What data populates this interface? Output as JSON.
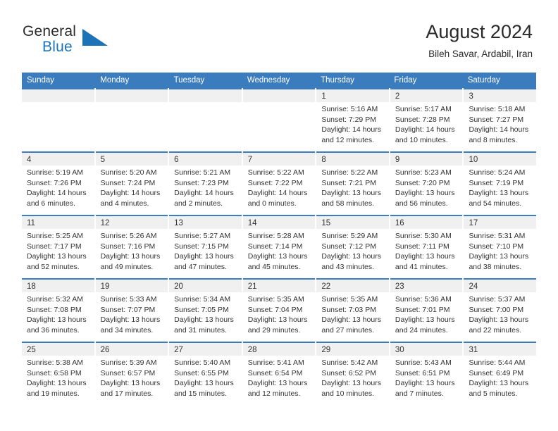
{
  "brand": {
    "word_one": "General",
    "word_two": "Blue",
    "logo_icon": "triangle-flag-icon"
  },
  "header": {
    "title": "August 2024",
    "subtitle": "Bileh Savar, Ardabil, Iran"
  },
  "colors": {
    "accent": "#3a7cbe",
    "brand_blue": "#1c73b8",
    "day_band": "#f0f0f0",
    "text": "#333333"
  },
  "weekdays": [
    "Sunday",
    "Monday",
    "Tuesday",
    "Wednesday",
    "Thursday",
    "Friday",
    "Saturday"
  ],
  "chart_data": {
    "type": "table",
    "title": "August 2024",
    "subtitle": "Bileh Savar, Ardabil, Iran",
    "columns": [
      "Sunday",
      "Monday",
      "Tuesday",
      "Wednesday",
      "Thursday",
      "Friday",
      "Saturday"
    ],
    "days": [
      {
        "day": 1,
        "sunrise": "5:16 AM",
        "sunset": "7:29 PM",
        "daylight_hours": 14,
        "daylight_minutes": 12
      },
      {
        "day": 2,
        "sunrise": "5:17 AM",
        "sunset": "7:28 PM",
        "daylight_hours": 14,
        "daylight_minutes": 10
      },
      {
        "day": 3,
        "sunrise": "5:18 AM",
        "sunset": "7:27 PM",
        "daylight_hours": 14,
        "daylight_minutes": 8
      },
      {
        "day": 4,
        "sunrise": "5:19 AM",
        "sunset": "7:26 PM",
        "daylight_hours": 14,
        "daylight_minutes": 6
      },
      {
        "day": 5,
        "sunrise": "5:20 AM",
        "sunset": "7:24 PM",
        "daylight_hours": 14,
        "daylight_minutes": 4
      },
      {
        "day": 6,
        "sunrise": "5:21 AM",
        "sunset": "7:23 PM",
        "daylight_hours": 14,
        "daylight_minutes": 2
      },
      {
        "day": 7,
        "sunrise": "5:22 AM",
        "sunset": "7:22 PM",
        "daylight_hours": 14,
        "daylight_minutes": 0
      },
      {
        "day": 8,
        "sunrise": "5:22 AM",
        "sunset": "7:21 PM",
        "daylight_hours": 13,
        "daylight_minutes": 58
      },
      {
        "day": 9,
        "sunrise": "5:23 AM",
        "sunset": "7:20 PM",
        "daylight_hours": 13,
        "daylight_minutes": 56
      },
      {
        "day": 10,
        "sunrise": "5:24 AM",
        "sunset": "7:19 PM",
        "daylight_hours": 13,
        "daylight_minutes": 54
      },
      {
        "day": 11,
        "sunrise": "5:25 AM",
        "sunset": "7:17 PM",
        "daylight_hours": 13,
        "daylight_minutes": 52
      },
      {
        "day": 12,
        "sunrise": "5:26 AM",
        "sunset": "7:16 PM",
        "daylight_hours": 13,
        "daylight_minutes": 49
      },
      {
        "day": 13,
        "sunrise": "5:27 AM",
        "sunset": "7:15 PM",
        "daylight_hours": 13,
        "daylight_minutes": 47
      },
      {
        "day": 14,
        "sunrise": "5:28 AM",
        "sunset": "7:14 PM",
        "daylight_hours": 13,
        "daylight_minutes": 45
      },
      {
        "day": 15,
        "sunrise": "5:29 AM",
        "sunset": "7:12 PM",
        "daylight_hours": 13,
        "daylight_minutes": 43
      },
      {
        "day": 16,
        "sunrise": "5:30 AM",
        "sunset": "7:11 PM",
        "daylight_hours": 13,
        "daylight_minutes": 41
      },
      {
        "day": 17,
        "sunrise": "5:31 AM",
        "sunset": "7:10 PM",
        "daylight_hours": 13,
        "daylight_minutes": 38
      },
      {
        "day": 18,
        "sunrise": "5:32 AM",
        "sunset": "7:08 PM",
        "daylight_hours": 13,
        "daylight_minutes": 36
      },
      {
        "day": 19,
        "sunrise": "5:33 AM",
        "sunset": "7:07 PM",
        "daylight_hours": 13,
        "daylight_minutes": 34
      },
      {
        "day": 20,
        "sunrise": "5:34 AM",
        "sunset": "7:05 PM",
        "daylight_hours": 13,
        "daylight_minutes": 31
      },
      {
        "day": 21,
        "sunrise": "5:35 AM",
        "sunset": "7:04 PM",
        "daylight_hours": 13,
        "daylight_minutes": 29
      },
      {
        "day": 22,
        "sunrise": "5:35 AM",
        "sunset": "7:03 PM",
        "daylight_hours": 13,
        "daylight_minutes": 27
      },
      {
        "day": 23,
        "sunrise": "5:36 AM",
        "sunset": "7:01 PM",
        "daylight_hours": 13,
        "daylight_minutes": 24
      },
      {
        "day": 24,
        "sunrise": "5:37 AM",
        "sunset": "7:00 PM",
        "daylight_hours": 13,
        "daylight_minutes": 22
      },
      {
        "day": 25,
        "sunrise": "5:38 AM",
        "sunset": "6:58 PM",
        "daylight_hours": 13,
        "daylight_minutes": 19
      },
      {
        "day": 26,
        "sunrise": "5:39 AM",
        "sunset": "6:57 PM",
        "daylight_hours": 13,
        "daylight_minutes": 17
      },
      {
        "day": 27,
        "sunrise": "5:40 AM",
        "sunset": "6:55 PM",
        "daylight_hours": 13,
        "daylight_minutes": 15
      },
      {
        "day": 28,
        "sunrise": "5:41 AM",
        "sunset": "6:54 PM",
        "daylight_hours": 13,
        "daylight_minutes": 12
      },
      {
        "day": 29,
        "sunrise": "5:42 AM",
        "sunset": "6:52 PM",
        "daylight_hours": 13,
        "daylight_minutes": 10
      },
      {
        "day": 30,
        "sunrise": "5:43 AM",
        "sunset": "6:51 PM",
        "daylight_hours": 13,
        "daylight_minutes": 7
      },
      {
        "day": 31,
        "sunrise": "5:44 AM",
        "sunset": "6:49 PM",
        "daylight_hours": 13,
        "daylight_minutes": 5
      }
    ],
    "leading_blank_cells": 4,
    "trailing_blank_cells": 0,
    "label_prefixes": {
      "sunrise": "Sunrise: ",
      "sunset": "Sunset: ",
      "daylight": "Daylight: ",
      "daylight_hours_suffix": " hours",
      "daylight_minutes_prefix": "and ",
      "daylight_minutes_suffix": " minutes."
    }
  }
}
